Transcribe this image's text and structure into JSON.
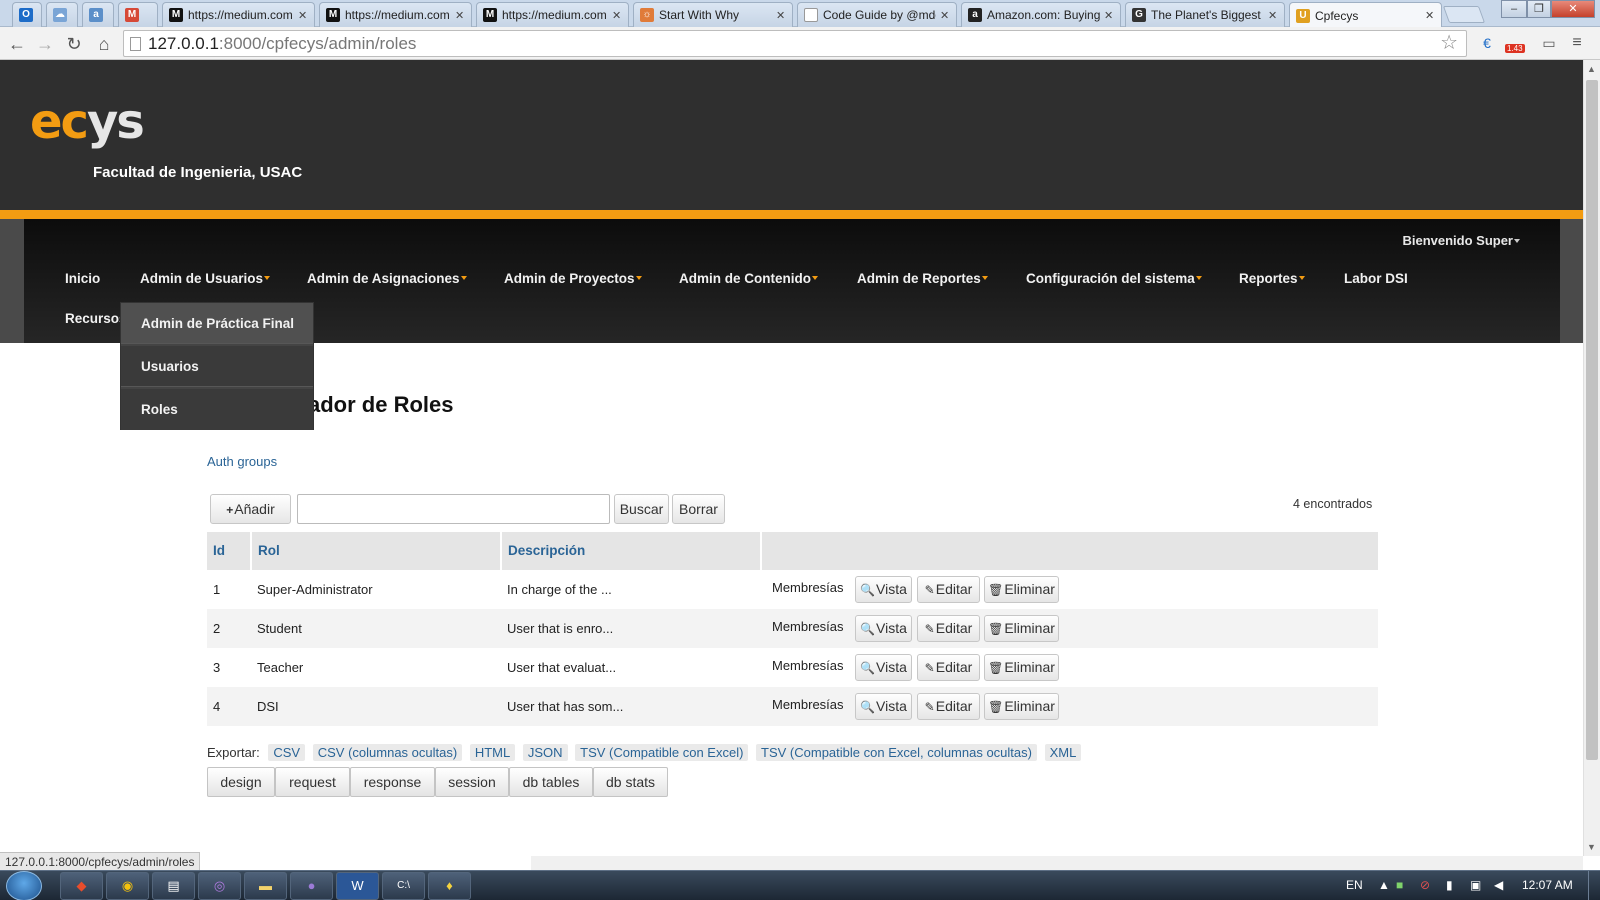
{
  "browser": {
    "tabs": [
      {
        "title": "",
        "favicon": "outlook-icon",
        "color": "#1d6cc8"
      },
      {
        "title": "",
        "favicon": "cloud-icon",
        "color": "#7aa5d6"
      },
      {
        "title": "",
        "favicon": "aol-icon",
        "color": "#5b8fc9"
      },
      {
        "title": "",
        "favicon": "gmail-icon",
        "color": "#d64937"
      },
      {
        "title": "https://medium.com",
        "favicon": "medium-icon",
        "color": "#111111"
      },
      {
        "title": "https://medium.com",
        "favicon": "medium-icon",
        "color": "#111111"
      },
      {
        "title": "https://medium.com",
        "favicon": "medium-icon",
        "color": "#111111"
      },
      {
        "title": "Start With Why",
        "favicon": "document-icon",
        "color": "#e07b39"
      },
      {
        "title": "Code Guide by @mdo",
        "favicon": "page-icon",
        "color": "#cccccc"
      },
      {
        "title": "Amazon.com: Buying",
        "favicon": "amazon-icon",
        "color": "#222222"
      },
      {
        "title": "The Planet's Biggest",
        "favicon": "g-icon",
        "color": "#333333"
      },
      {
        "title": "Cpfecys",
        "favicon": "usac-icon",
        "color": "#e0a020"
      }
    ],
    "url_host": "127.0.0.1",
    "url_path": ":8000/cpfecys/admin/roles",
    "ext_badge": "1.43",
    "status_url": "127.0.0.1:8000/cpfecys/admin/roles"
  },
  "site": {
    "logo_ec": "ec",
    "logo_ys": "ys",
    "faculty": "Facultad de Ingenieria, USAC",
    "welcome": "Bienvenido Super",
    "nav": {
      "inicio": "Inicio",
      "usuarios": "Admin de Usuarios",
      "asignaciones": "Admin de Asignaciones",
      "proyectos": "Admin de Proyectos",
      "contenido": "Admin de Contenido",
      "reportes_admin": "Admin de Reportes",
      "config": "Configuración del sistema",
      "reportes": "Reportes",
      "labor": "Labor DSI",
      "recursos": "Recursos"
    },
    "dropdown": [
      "Admin de Práctica Final",
      "Usuarios",
      "Roles"
    ],
    "accent": "#f39c12"
  },
  "main": {
    "title_visible": "ador de Roles",
    "auth_link": "Auth groups",
    "add_label": "Añadir",
    "search_label": "Buscar",
    "clear_label": "Borrar",
    "found": "4 encontrados",
    "headers": {
      "id": "Id",
      "rol": "Rol",
      "desc": "Descripción"
    },
    "rows": [
      {
        "id": "1",
        "rol": "Super-Administrator",
        "desc": "In charge of the ...",
        "memb": "Membresías",
        "vista": "Vista",
        "editar": "Editar",
        "eliminar": "Eliminar"
      },
      {
        "id": "2",
        "rol": "Student",
        "desc": "User that is enro...",
        "memb": "Membresías",
        "vista": "Vista",
        "editar": "Editar",
        "eliminar": "Eliminar"
      },
      {
        "id": "3",
        "rol": "Teacher",
        "desc": "User that evaluat...",
        "memb": "Membresías",
        "vista": "Vista",
        "editar": "Editar",
        "eliminar": "Eliminar"
      },
      {
        "id": "4",
        "rol": "DSI",
        "desc": "User that has som...",
        "memb": "Membresías",
        "vista": "Vista",
        "editar": "Editar",
        "eliminar": "Eliminar"
      }
    ],
    "export_label": "Exportar:",
    "export_formats": [
      "CSV",
      "CSV (columnas ocultas)",
      "HTML",
      "JSON",
      "TSV (Compatible con Excel)",
      "TSV (Compatible con Excel, columnas ocultas)",
      "XML"
    ],
    "debug_buttons": [
      "design",
      "request",
      "response",
      "session",
      "db tables",
      "db stats"
    ]
  },
  "taskbar": {
    "lang": "EN",
    "time": "12:07 AM"
  }
}
